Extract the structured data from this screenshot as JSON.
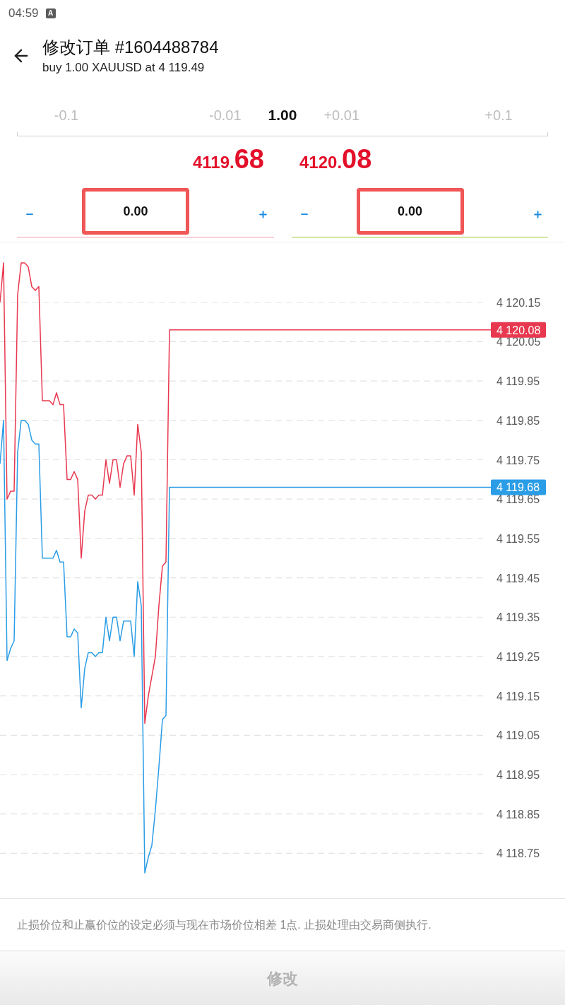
{
  "status_bar": {
    "time": "04:59",
    "indicator": "A"
  },
  "header": {
    "title": "修改订单 #1604488784",
    "subtitle": "buy 1.00 XAUUSD at 4 119.49"
  },
  "volume_stepper": [
    {
      "kind": "step",
      "label": "-0.1"
    },
    {
      "kind": "step",
      "label": "-0.01"
    },
    {
      "kind": "value",
      "label": "1.00"
    },
    {
      "kind": "step",
      "label": "+0.01"
    },
    {
      "kind": "step",
      "label": "+0.1"
    }
  ],
  "price_fields": [
    {
      "price": "4119.68",
      "value": "0.00",
      "color": "#f29aa5",
      "highlighted": true
    },
    {
      "price": "4120.08",
      "value": "0.00",
      "color": "#9ccc30",
      "highlighted": true
    }
  ],
  "chart": {
    "chart_data": {
      "type": "line",
      "categories": [
        null,
        null,
        null,
        null,
        null,
        null,
        null,
        null,
        null,
        null,
        null,
        null,
        null,
        null,
        null,
        null,
        null,
        null,
        null,
        null,
        null,
        null,
        null,
        null,
        null,
        null,
        null,
        null,
        null,
        null,
        null,
        null,
        null,
        null,
        null,
        null,
        null,
        null,
        null,
        null,
        null,
        null,
        null,
        null,
        null,
        null,
        null,
        null,
        null,
        null,
        null,
        null,
        null,
        null,
        null,
        null,
        null,
        null,
        null,
        null,
        null,
        null,
        null,
        null,
        null,
        null,
        null,
        null,
        null,
        null,
        null,
        null,
        null,
        null,
        null,
        null,
        null,
        null,
        null,
        null,
        null,
        null,
        null,
        null,
        null,
        null,
        null,
        null,
        null,
        null,
        null,
        null,
        null,
        null,
        null,
        null,
        null,
        null,
        null,
        null,
        null,
        null,
        null,
        null,
        null,
        null,
        null,
        null,
        null,
        null,
        null,
        null,
        null,
        null,
        null,
        null,
        null,
        null,
        null,
        null,
        null,
        null,
        null,
        null,
        null,
        null,
        null,
        null,
        null,
        null,
        null,
        null,
        null,
        null,
        null,
        null,
        null,
        null,
        null,
        null
      ],
      "series": [
        {
          "color": "#e8384f",
          "values": [
            4120.15,
            4120.25,
            4119.65,
            4119.67,
            4119.67,
            4120.17,
            4120.25,
            4120.25,
            4120.24,
            4120.19,
            4120.18,
            4120.19,
            4119.9,
            4119.9,
            4119.9,
            4119.89,
            4119.92,
            4119.89,
            4119.89,
            4119.7,
            4119.7,
            4119.72,
            4119.7,
            4119.5,
            4119.62,
            4119.66,
            4119.66,
            4119.65,
            4119.66,
            4119.66,
            4119.75,
            4119.69,
            4119.75,
            4119.75,
            4119.68,
            4119.74,
            4119.76,
            4119.76,
            4119.66,
            4119.84,
            4119.77,
            4119.08,
            4119.15,
            4119.2,
            4119.25,
            4119.38,
            4119.48,
            4119.49,
            4120.08,
            4120.08,
            4120.08,
            4120.08,
            4120.08,
            4120.08,
            4120.08,
            4120.08,
            4120.08,
            4120.08,
            4120.08,
            4120.08,
            4120.08,
            4120.08,
            4120.08,
            4120.08,
            4120.08,
            4120.08,
            4120.08,
            4120.08,
            4120.08,
            4120.08,
            4120.08,
            4120.08,
            4120.08,
            4120.08,
            4120.08,
            4120.08,
            4120.08,
            4120.08,
            4120.08,
            4120.08,
            4120.08,
            4120.08,
            4120.08,
            4120.08,
            4120.08,
            4120.08,
            4120.08,
            4120.08,
            4120.08,
            4120.08,
            4120.08,
            4120.08,
            4120.08,
            4120.08,
            4120.08,
            4120.08,
            4120.08,
            4120.08,
            4120.08,
            4120.08,
            4120.08,
            4120.08,
            4120.08,
            4120.08,
            4120.08,
            4120.08,
            4120.08,
            4120.08,
            4120.08,
            4120.08,
            4120.08,
            4120.08,
            4120.08,
            4120.08,
            4120.08,
            4120.08,
            4120.08,
            4120.08,
            4120.08,
            4120.08,
            4120.08,
            4120.08,
            4120.08,
            4120.08,
            4120.08,
            4120.08,
            4120.08,
            4120.08,
            4120.08,
            4120.08,
            4120.08,
            4120.08,
            4120.08,
            4120.08,
            4120.08,
            4120.08,
            4120.08,
            4120.08,
            4120.08,
            4120.08
          ]
        },
        {
          "color": "#2a9de6",
          "values": [
            4119.74,
            4119.85,
            4119.24,
            4119.27,
            4119.29,
            4119.77,
            4119.85,
            4119.85,
            4119.84,
            4119.8,
            4119.79,
            4119.79,
            4119.5,
            4119.5,
            4119.5,
            4119.5,
            4119.52,
            4119.49,
            4119.49,
            4119.3,
            4119.3,
            4119.32,
            4119.31,
            4119.12,
            4119.22,
            4119.26,
            4119.26,
            4119.25,
            4119.26,
            4119.26,
            4119.35,
            4119.29,
            4119.35,
            4119.35,
            4119.29,
            4119.34,
            4119.34,
            4119.34,
            4119.25,
            4119.44,
            4119.38,
            4118.7,
            4118.74,
            4118.77,
            4118.86,
            4118.97,
            4119.09,
            4119.1,
            4119.68,
            4119.68,
            4119.68,
            4119.68,
            4119.68,
            4119.68,
            4119.68,
            4119.68,
            4119.68,
            4119.68,
            4119.68,
            4119.68,
            4119.68,
            4119.68,
            4119.68,
            4119.68,
            4119.68,
            4119.68,
            4119.68,
            4119.68,
            4119.68,
            4119.68,
            4119.68,
            4119.68,
            4119.68,
            4119.68,
            4119.68,
            4119.68,
            4119.68,
            4119.68,
            4119.68,
            4119.68,
            4119.68,
            4119.68,
            4119.68,
            4119.68,
            4119.68,
            4119.68,
            4119.68,
            4119.68,
            4119.68,
            4119.68,
            4119.68,
            4119.68,
            4119.68,
            4119.68,
            4119.68,
            4119.68,
            4119.68,
            4119.68,
            4119.68,
            4119.68,
            4119.68,
            4119.68,
            4119.68,
            4119.68,
            4119.68,
            4119.68,
            4119.68,
            4119.68,
            4119.68,
            4119.68,
            4119.68,
            4119.68,
            4119.68,
            4119.68,
            4119.68,
            4119.68,
            4119.68,
            4119.68,
            4119.68,
            4119.68,
            4119.68,
            4119.68,
            4119.68,
            4119.68,
            4119.68,
            4119.68,
            4119.68,
            4119.68,
            4119.68,
            4119.68,
            4119.68,
            4119.68,
            4119.68,
            4119.68,
            4119.68,
            4119.68,
            4119.68,
            4119.68,
            4119.68,
            4119.68
          ]
        }
      ],
      "ylim": [
        4118.634,
        4120.304
      ],
      "yticks": [
        {
          "value": 4120.15,
          "label": "4 120.15"
        },
        {
          "value": 4120.05,
          "label": "4 120.05"
        },
        {
          "value": 4119.95,
          "label": "4 119.95"
        },
        {
          "value": 4119.85,
          "label": "4 119.85"
        },
        {
          "value": 4119.75,
          "label": "4 119.75"
        },
        {
          "value": 4119.65,
          "label": "4 119.65"
        },
        {
          "value": 4119.55,
          "label": "4 119.55"
        },
        {
          "value": 4119.45,
          "label": "4 119.45"
        },
        {
          "value": 4119.35,
          "label": "4 119.35"
        },
        {
          "value": 4119.25,
          "label": "4 119.25"
        },
        {
          "value": 4119.15,
          "label": "4 119.15"
        },
        {
          "value": 4119.05,
          "label": "4 119.05"
        },
        {
          "value": 4118.95,
          "label": "4 118.95"
        },
        {
          "value": 4118.85,
          "label": "4 118.85"
        },
        {
          "value": 4118.75,
          "label": "4 118.75"
        }
      ],
      "grid": true,
      "annotations": [
        "4 120.08",
        "4 119.68"
      ]
    }
  },
  "note": "止损价位和止赢价位的设定必须与现在市场价位相差 1点. 止损处理由交易商侧执行.",
  "submit_button": {
    "label": "修改",
    "disabled": true
  }
}
